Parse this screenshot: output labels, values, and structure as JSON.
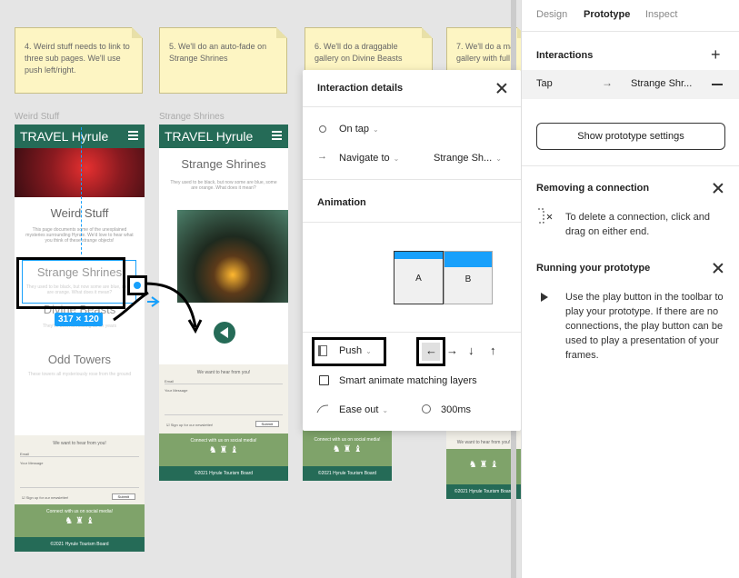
{
  "notes": [
    "4. Weird stuff needs to link to three sub pages. We'll use push left/right.",
    "5. We'll do an auto-fade on Strange Shrines",
    "6. We'll do a draggable gallery on Divine Beasts",
    "7. We'll do a ma gallery with full"
  ],
  "frame_labels": {
    "weird": "Weird Stuff",
    "strange": "Strange Shrines"
  },
  "site": {
    "brand": "TRAVEL Hyrule",
    "weird_title": "Weird Stuff",
    "weird_desc": "This page documents some of the unexplained mysteries surrounding Hyrule. We'd love to hear what you think of these strange objects!",
    "shrines_title": "Strange Shrines",
    "shrines_desc": "They used to be black, but now some are blue, some are orange. What does it mean?",
    "beasts_title": "Divine Beasts",
    "beasts_desc": "They've been terrorizing us for years",
    "towers_title": "Odd Towers",
    "towers_desc": "These towers all mysteriously rose from the ground",
    "form_title": "We want to hear from you!",
    "email": "Email",
    "message": "Your Message",
    "signup": "Sign up for our newsletter!",
    "submit": "Submit",
    "social": "Connect with us on social media!",
    "footer": "©2021 Hyrule Tourism Board",
    "selection_size": "317 × 120"
  },
  "panel": {
    "tabs": [
      "Design",
      "Prototype",
      "Inspect"
    ],
    "interactions_title": "Interactions",
    "interaction_trigger": "Tap",
    "interaction_target": "Strange Shr...",
    "settings_button": "Show prototype settings",
    "removing_title": "Removing a connection",
    "removing_text": "To delete a connection, click and drag on either end.",
    "running_title": "Running your prototype",
    "running_text": "Use the play button in the toolbar to play your prototype. If there are no connections, the play button can be used to play a presentation of your frames."
  },
  "modal": {
    "title": "Interaction details",
    "trigger": "On tap",
    "action": "Navigate to",
    "destination": "Strange Sh...",
    "animation_title": "Animation",
    "frame_a": "A",
    "frame_b": "B",
    "transition": "Push",
    "directions": [
      "←",
      "→",
      "↓",
      "↑"
    ],
    "smart_animate": "Smart animate matching layers",
    "easing": "Ease out",
    "duration": "300ms"
  },
  "colors": {
    "brand_green": "#256b57",
    "selection_blue": "#18a0fb",
    "accent_blue": "#18a0fb"
  }
}
